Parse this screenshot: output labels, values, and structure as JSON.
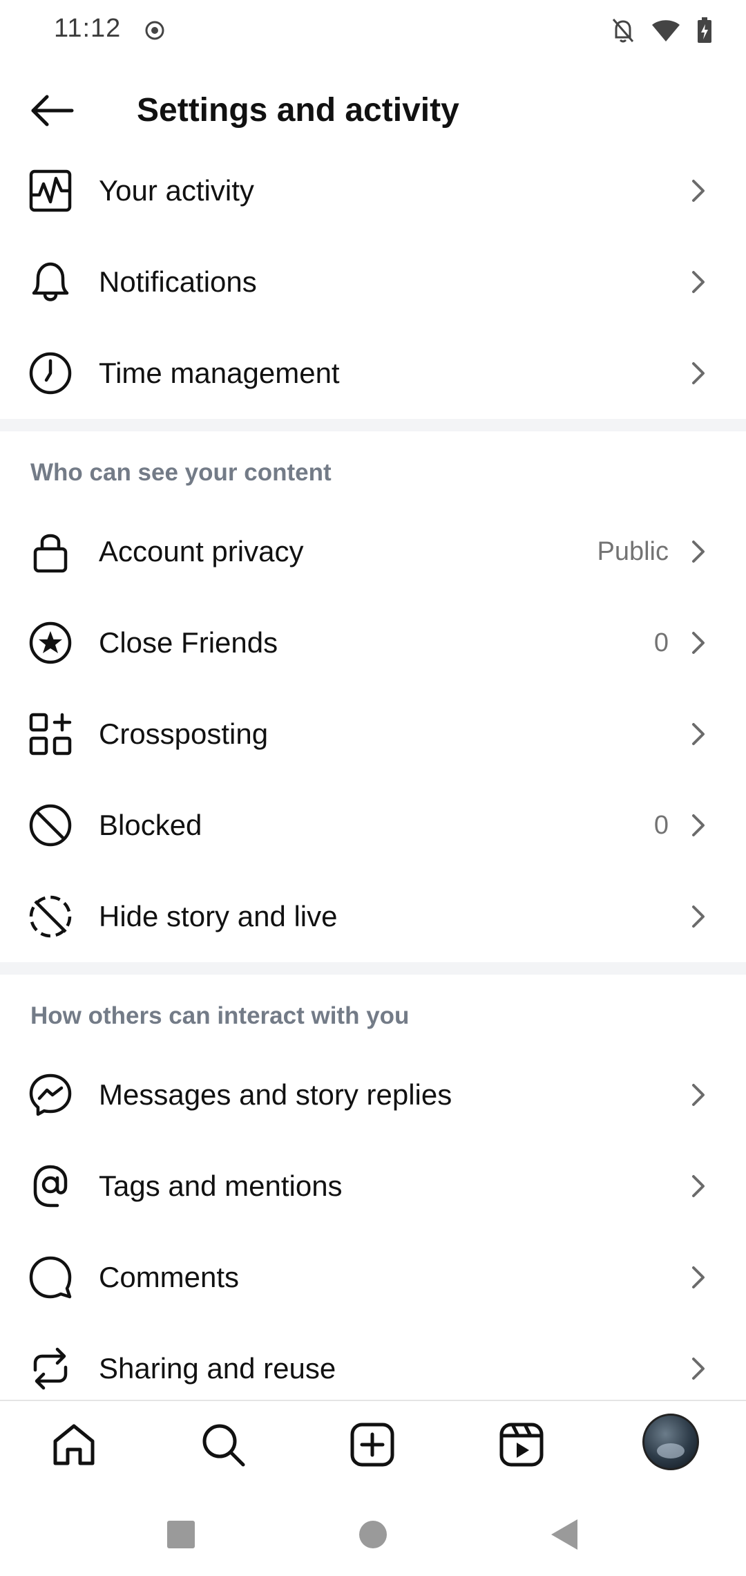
{
  "status_bar": {
    "time": "11:12",
    "icons": [
      "record-icon",
      "notifications-off-icon",
      "wifi-icon",
      "battery-charging-icon"
    ]
  },
  "header": {
    "title": "Settings and activity",
    "back_icon": "arrow-left-icon"
  },
  "groups": [
    {
      "items": [
        {
          "label": "Your activity",
          "icon": "activity-icon"
        },
        {
          "label": "Notifications",
          "icon": "bell-icon"
        },
        {
          "label": "Time management",
          "icon": "clock-icon"
        }
      ]
    },
    {
      "header": "Who can see your content",
      "items": [
        {
          "label": "Account privacy",
          "value": "Public",
          "icon": "lock-icon"
        },
        {
          "label": "Close Friends",
          "value": "0",
          "icon": "star-circle-icon"
        },
        {
          "label": "Crossposting",
          "icon": "grid-plus-icon"
        },
        {
          "label": "Blocked",
          "value": "0",
          "icon": "blocked-icon"
        },
        {
          "label": "Hide story and live",
          "icon": "hide-story-icon"
        }
      ]
    },
    {
      "header": "How others can interact with you",
      "items": [
        {
          "label": "Messages and story replies",
          "icon": "messenger-icon"
        },
        {
          "label": "Tags and mentions",
          "icon": "at-sign-icon"
        },
        {
          "label": "Comments",
          "icon": "comment-icon"
        },
        {
          "label": "Sharing and reuse",
          "icon": "share-reuse-icon"
        }
      ]
    }
  ],
  "bottom_nav": [
    "home-icon",
    "search-icon",
    "create-icon",
    "reels-icon",
    "profile-avatar"
  ],
  "system_nav": [
    "recents-button",
    "home-button",
    "back-button"
  ]
}
